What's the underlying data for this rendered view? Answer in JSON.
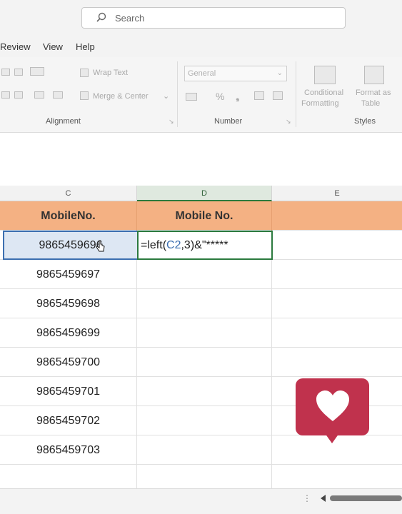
{
  "search": {
    "placeholder": "Search"
  },
  "menu": [
    "Review",
    "View",
    "Help"
  ],
  "ribbon": {
    "wrap_text": "Wrap Text",
    "merge_center": "Merge & Center",
    "alignment_label": "Alignment",
    "number_format": "General",
    "number_label": "Number",
    "conditional_formatting_line1": "Conditional",
    "conditional_formatting_line2": "Formatting",
    "format_as_table_line1": "Format as",
    "format_as_table_line2": "Table",
    "styles_label": "Styles"
  },
  "columns": [
    "C",
    "D",
    "E"
  ],
  "headers": [
    "MobileNo.",
    "Mobile No."
  ],
  "formula": {
    "prefix": "=left(",
    "ref": "C2",
    "suffix": ",3)&\"*****"
  },
  "mobile_numbers": [
    "9865459696",
    "9865459697",
    "9865459698",
    "9865459699",
    "9865459700",
    "9865459701",
    "9865459702",
    "9865459703"
  ],
  "colors": {
    "header_fill": "#f4b183",
    "selection": "#3c6fb0",
    "edit_border": "#2b7a3e",
    "badge": "#c0324d"
  }
}
